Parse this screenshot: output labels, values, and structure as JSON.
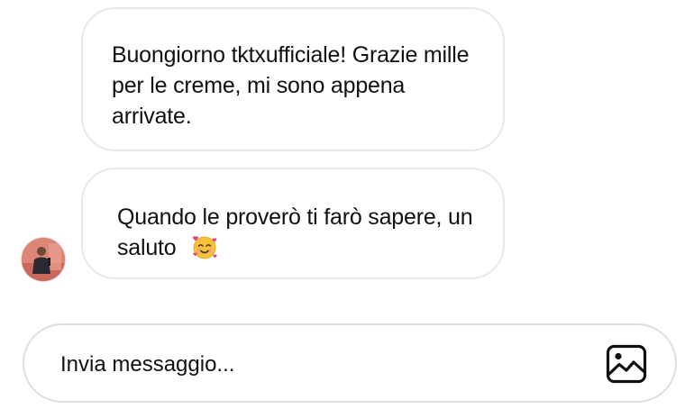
{
  "messages": [
    {
      "text": "Buongiorno tktxufficiale! Grazie mille per le creme, mi sono appena arrivate."
    },
    {
      "text": "Quando le proverò ti farò sapere, un saluto",
      "emoji": "smiling-face-with-hearts-icon"
    }
  ],
  "sender": {
    "avatar": "avatar"
  },
  "composer": {
    "placeholder": "Invia messaggio...",
    "image_icon": "image-icon"
  },
  "colors": {
    "bubble_border": "#e8e8e8",
    "composer_border": "#dedede",
    "text": "#111111",
    "background": "#ffffff"
  }
}
